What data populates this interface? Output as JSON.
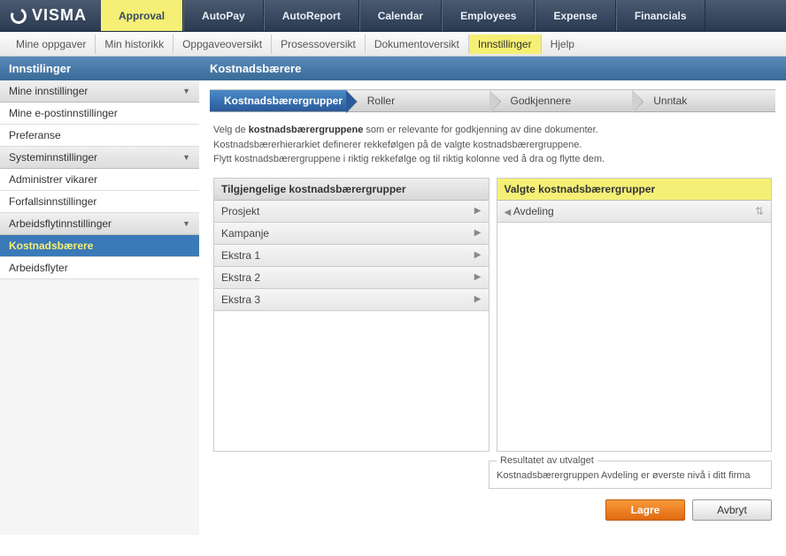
{
  "brand": "VISMA",
  "topnav": [
    "Approval",
    "AutoPay",
    "AutoReport",
    "Calendar",
    "Employees",
    "Expense",
    "Financials"
  ],
  "topnav_active": 0,
  "subnav": [
    "Mine oppgaver",
    "Min historikk",
    "Oppgaveoversikt",
    "Prosessoversikt",
    "Dokumentoversikt",
    "Innstillinger",
    "Hjelp"
  ],
  "subnav_active": 5,
  "sidebar": {
    "title": "Innstilinger",
    "groups": [
      {
        "label": "Mine innstillinger",
        "items": [
          "Mine e-postinnstillinger",
          "Preferanse"
        ]
      },
      {
        "label": "Systeminnstillinger",
        "items": [
          "Administrer vikarer",
          "Forfallsinnstillinger"
        ]
      },
      {
        "label": "Arbeidsflytinnstillinger",
        "items": [
          "Kostnadsbærere",
          "Arbeidsflyter"
        ],
        "active_item": 0
      }
    ]
  },
  "content": {
    "title": "Kostnadsbærere",
    "steps": [
      "Kostnadsbærergrupper",
      "Roller",
      "Godkjennere",
      "Unntak"
    ],
    "active_step": 0,
    "intro_pre": "Velg de ",
    "intro_bold": "kostnadsbærergruppene",
    "intro_post": " som er relevante for godkjenning av dine dokumenter.",
    "intro_line2": "Kostnadsbærerhierarkiet definerer rekkefølgen på de valgte kostnadsbærergruppene.",
    "intro_line3": "Flytt kostnadsbærergruppene i riktig rekkefølge og til riktig kolonne ved å dra og flytte dem.",
    "available_title": "Tilgjengelige kostnadsbærergrupper",
    "selected_title": "Valgte kostnadsbærergrupper",
    "available": [
      "Prosjekt",
      "Kampanje",
      "Ekstra 1",
      "Ekstra 2",
      "Ekstra 3"
    ],
    "selected": [
      "Avdeling"
    ],
    "result_legend": "Resultatet av utvalget",
    "result_text": "Kostnadsbærergruppen Avdeling er øverste nivå i ditt firma",
    "save": "Lagre",
    "cancel": "Avbryt"
  }
}
